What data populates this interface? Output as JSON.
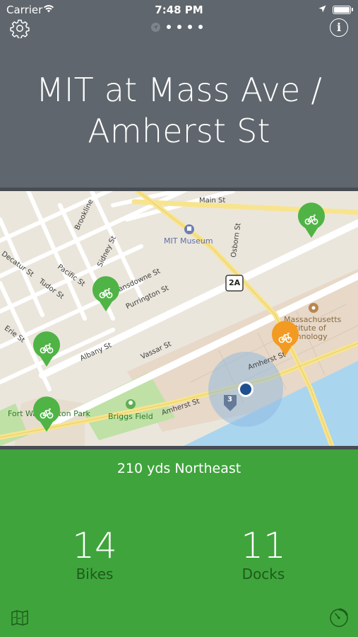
{
  "status_bar": {
    "carrier": "Carrier",
    "time": "7:48 PM"
  },
  "header": {
    "title": "MIT at Mass Ave / Amherst St",
    "page_count": 4
  },
  "map": {
    "streets": {
      "main_st": "Main St",
      "brookline": "Brookline",
      "sidney": "Sidney St",
      "lansdowne": "Lansdowne St",
      "purrington": "Purrington St",
      "decatur": "Decatur St",
      "pacific": "Pacific St",
      "tudor": "Tudor St",
      "erie": "Erie St",
      "albany": "Albany St",
      "vassar": "Vassar St",
      "osborn": "Osborn St",
      "amherst_1": "Amherst St",
      "amherst_2": "Amherst St"
    },
    "pois": {
      "mit_museum": "MIT Museum",
      "briggs_field": "Briggs Field",
      "mit_1": "Massachusetts",
      "mit_2": "Institute of",
      "mit_3": "Technology",
      "fort": "Fort Washington Park"
    },
    "route_shields": {
      "route_2a": "2A",
      "route_3": "3"
    }
  },
  "station": {
    "distance": "210 yds Northeast",
    "bikes": {
      "count": "14",
      "label": "Bikes"
    },
    "docks": {
      "count": "11",
      "label": "Docks"
    }
  },
  "colors": {
    "header": "#5f666d",
    "panel": "#3fa43c",
    "pin_green": "#4fb445",
    "pin_orange": "#f39a22",
    "user_dot": "#1f4f8f"
  },
  "icons": {
    "settings": "gear-icon",
    "info": "info-icon",
    "map": "map-icon",
    "timer": "timer-icon"
  }
}
